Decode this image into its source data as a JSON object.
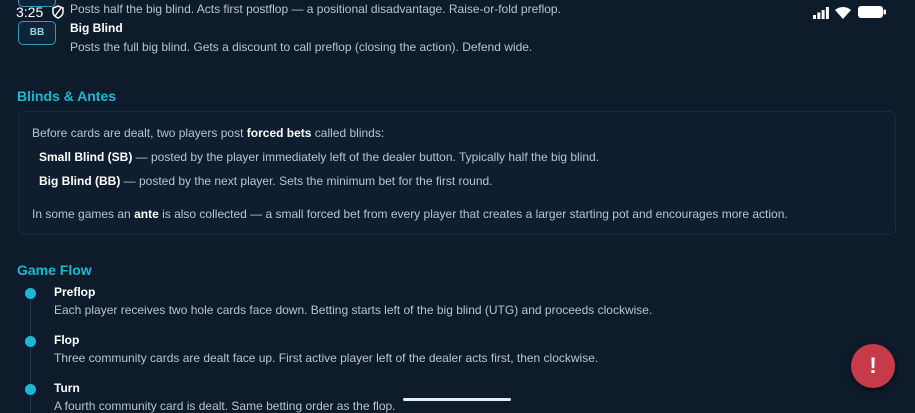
{
  "status": {
    "time": "3:25"
  },
  "positions": [
    {
      "badge": "",
      "title": "",
      "desc": "Posts half the big blind. Acts first postflop — a positional disadvantage. Raise-or-fold preflop."
    },
    {
      "badge": "BB",
      "title": "Big Blind",
      "desc": "Posts the full big blind. Gets a discount to call preflop (closing the action). Defend wide."
    }
  ],
  "blinds": {
    "title": "Blinds & Antes",
    "intro_before": "Before cards are dealt, two players post ",
    "intro_bold": "forced bets",
    "intro_after": " called blinds:",
    "sb_label": "Small Blind (SB)",
    "sb_text": " — posted by the player immediately left of the dealer button. Typically half the big blind.",
    "bb_label": "Big Blind (BB)",
    "bb_text": " — posted by the next player. Sets the minimum bet for the first round.",
    "ante_before": "In some games an ",
    "ante_bold": "ante",
    "ante_after": " is also collected — a small forced bet from every player that creates a larger starting pot and encourages more action."
  },
  "flow": {
    "title": "Game Flow",
    "steps": [
      {
        "title": "Preflop",
        "desc": "Each player receives two hole cards face down. Betting starts left of the big blind (UTG) and proceeds clockwise."
      },
      {
        "title": "Flop",
        "desc": "Three community cards are dealt face up. First active player left of the dealer acts first, then clockwise."
      },
      {
        "title": "Turn",
        "desc": "A fourth community card is dealt. Same betting order as the flop."
      }
    ]
  },
  "fab": {
    "label": "!"
  },
  "colors": {
    "accent": "#19b9d6",
    "background": "#0d1b2a",
    "fab": "#c73a4a"
  }
}
